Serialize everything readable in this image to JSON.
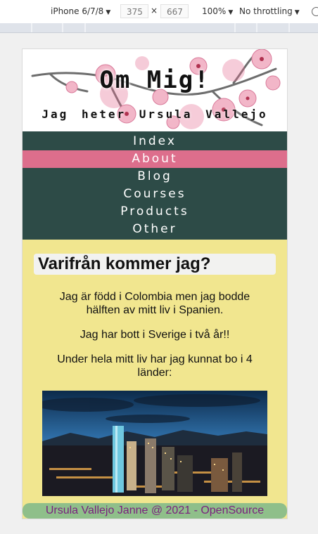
{
  "devtools": {
    "device": "iPhone 6/7/8",
    "width": "375",
    "height": "667",
    "times": "×",
    "zoom": "100%",
    "throttling": "No throttling"
  },
  "hero": {
    "title": "Om Mig!",
    "subtitle": "Jag heter Ursula Vallejo"
  },
  "nav": {
    "items": [
      "Index",
      "About",
      "Blog",
      "Courses",
      "Products",
      "Other"
    ],
    "active": "About"
  },
  "content": {
    "heading": "Varifrån kommer jag?",
    "paragraphs": [
      "Jag är född i Colombia men jag bodde hälften av mitt liv i Spanien.",
      "Jag har bott i Sverige i två år!!",
      "Under hela mitt liv har jag kunnat bo i 4 länder:"
    ],
    "image": "city-skyline-photo"
  },
  "footer": {
    "text": "Ursula Vallejo Janne @ 2021 - OpenSource"
  },
  "colors": {
    "nav_bg": "#2d4b47",
    "active": "#dd6e8c",
    "content_bg": "#f1e68f",
    "footer_bg": "#8fbf8a",
    "footer_text": "#7a1f7e"
  }
}
